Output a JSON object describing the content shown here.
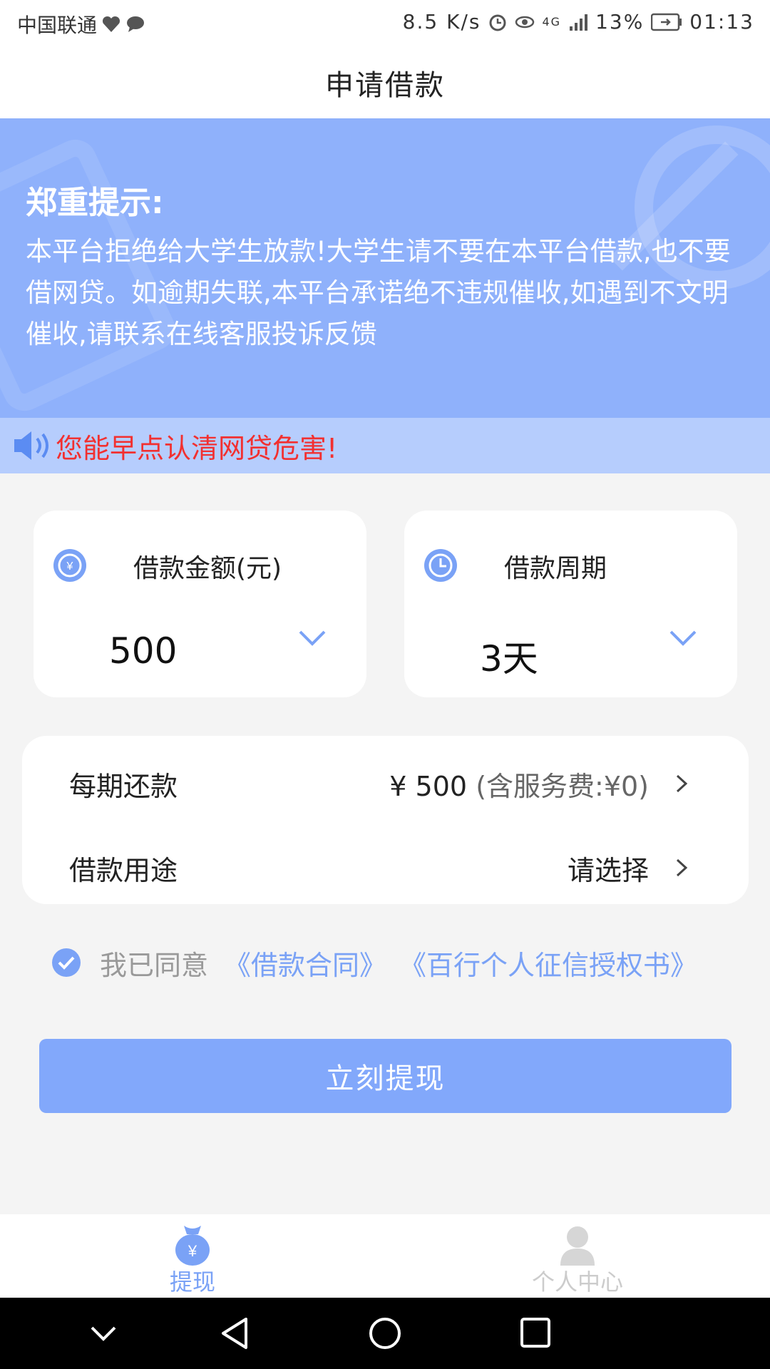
{
  "status_bar": {
    "carrier": "中国联通",
    "speed": "8.5 K/s",
    "network": "4G",
    "battery": "13%",
    "time": "01:13"
  },
  "nav": {
    "title": "申请借款"
  },
  "banner": {
    "heading": "郑重提示:",
    "body": "本平台拒绝给大学生放款!大学生请不要在本平台借款,也不要借网贷。如逾期失联,本平台承诺绝不违规催收,如遇到不文明催收,请联系在线客服投诉反馈"
  },
  "notice": {
    "text": "您能早点认清网贷危害!"
  },
  "amount_card": {
    "label": "借款金额(元)",
    "value": "500",
    "icon": "yuan-coin-icon"
  },
  "period_card": {
    "label": "借款周期",
    "value": "3天",
    "icon": "clock-icon"
  },
  "repayment": {
    "label": "每期还款",
    "amount": "¥ 500",
    "fee": "(含服务费:¥0)"
  },
  "purpose": {
    "label": "借款用途",
    "placeholder": "请选择"
  },
  "agreement": {
    "prefix": "我已同意",
    "contract": "《借款合同》",
    "credit_auth": "《百行个人征信授权书》",
    "checked": true
  },
  "submit": {
    "label": "立刻提现"
  },
  "tabs": [
    {
      "label": "提现",
      "icon": "money-bag-icon",
      "active": true
    },
    {
      "label": "个人中心",
      "icon": "person-icon",
      "active": false
    }
  ],
  "colors": {
    "accent": "#82a8fb",
    "banner": "#8fb1fb",
    "notice_bg": "#b6cdfd",
    "warning": "#f23030",
    "link": "#7aa2f6"
  }
}
